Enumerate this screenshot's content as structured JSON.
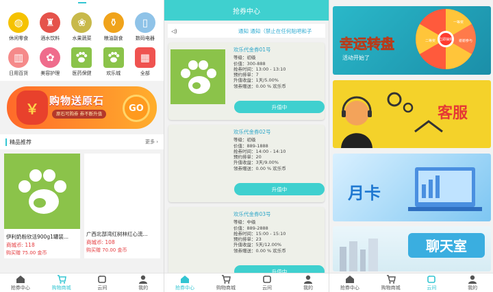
{
  "screen1": {
    "categories": [
      {
        "label": "休闲零食",
        "icon": "snack-icon",
        "color": "#f5c200"
      },
      {
        "label": "酒水饮料",
        "icon": "wine-icon",
        "color": "#e5534b"
      },
      {
        "label": "水果蔬菜",
        "icon": "fruit-icon",
        "color": "#8bb33a"
      },
      {
        "label": "粮油副食",
        "icon": "oil-icon",
        "color": "#f0a31b"
      },
      {
        "label": "数码电器",
        "icon": "appliance-icon",
        "color": "#8fc3e8"
      },
      {
        "label": "日用百货",
        "icon": "daily-goods-icon",
        "color": "#f58a8a"
      },
      {
        "label": "美容护理",
        "icon": "beauty-icon",
        "color": "#ef6c8c"
      },
      {
        "label": "医药保健",
        "icon": "medicine-icon",
        "color": "#8bc34a"
      },
      {
        "label": "欢乐城",
        "icon": "paw-icon",
        "color": "#8bc34a"
      },
      {
        "label": "全部",
        "icon": "all-icon",
        "color": "#ef5350"
      }
    ],
    "banner": {
      "title": "购物送原石",
      "sub": "原石可购券 券不断升值",
      "go": "GO"
    },
    "recommend": {
      "title": "精品推荐",
      "more": "更多"
    },
    "products": [
      {
        "name": "伊利奶粉欣活900g1罐装...",
        "price": "商城币: 118",
        "buy": "购买赠 75.00 金币"
      },
      {
        "name": "广西北部湾红树林红心流...",
        "price": "商城币: 108",
        "buy": "购买赠 70.00 金币"
      }
    ]
  },
  "screen2": {
    "title": "抢券中心",
    "notice": "通知 通知（禁止在任何贴吧和子",
    "coupons": [
      {
        "name": "欢乐代金券01号",
        "rows": [
          "等级：初级",
          "价值：300-888",
          "抢券时间：13:00 - 13:10",
          "预约排单：7",
          "升值收益：1天/5.00%",
          "领券赠送：0.00 % 欢乐币"
        ],
        "btn": "升值中"
      },
      {
        "name": "欢乐代金券02号",
        "rows": [
          "等级：初级",
          "价值：889-1888",
          "抢券时间：14:00 - 14:10",
          "预约排单：20",
          "升值收益：3天/9.00%",
          "领券赠送：0.00 % 欢乐币"
        ],
        "btn": "升值中"
      },
      {
        "name": "欢乐代金券03号",
        "rows": [
          "等级：中级",
          "价值：889-2888",
          "抢券时间：15:00 - 15:10",
          "预约排单：23",
          "升值收益：5天/12.00%",
          "领券赠送：0.00 % 欢乐币"
        ],
        "btn": "升值中"
      }
    ]
  },
  "screen3": {
    "banners": [
      {
        "title": "幸运转盘",
        "sub": "活动开始了",
        "wheel": [
          "一等奖",
          "二等奖",
          "谢谢参与",
          "立即抽奖"
        ]
      },
      {
        "title": "客服"
      },
      {
        "title": "月卡"
      },
      {
        "title": "聊天室"
      }
    ]
  },
  "tabs": [
    "抢券中心",
    "购物商城",
    "云间",
    "我的"
  ]
}
